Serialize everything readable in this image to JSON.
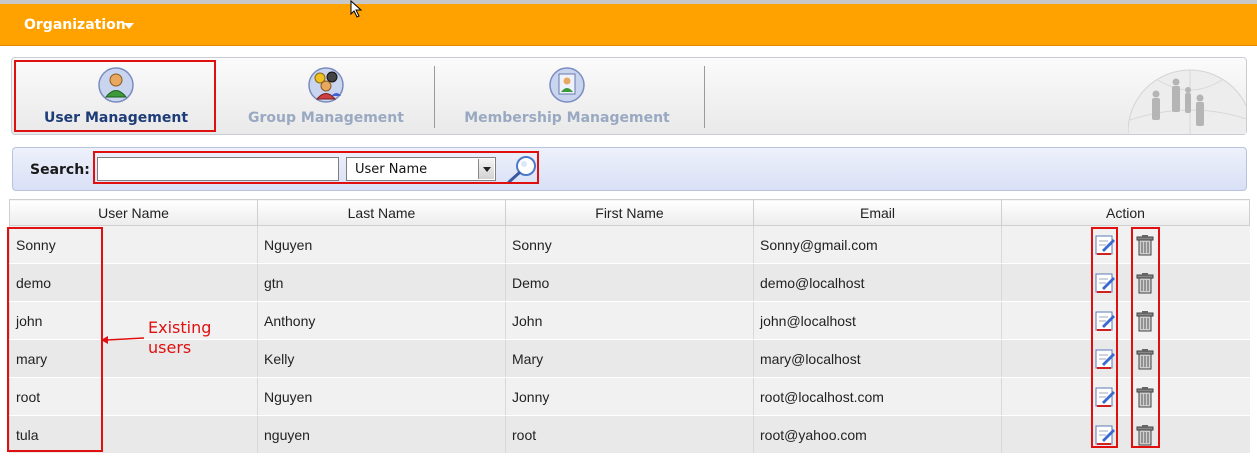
{
  "header": {
    "title": "Organization",
    "accent_color": "#ffa200",
    "menu_icon": "chevron-down-icon"
  },
  "tabs": [
    {
      "label": "User Management",
      "icon": "user-icon",
      "active": true
    },
    {
      "label": "Group Management",
      "icon": "group-icon",
      "active": false
    },
    {
      "label": "Membership Management",
      "icon": "membership-icon",
      "active": false
    }
  ],
  "search": {
    "label": "Search:",
    "value": "",
    "placeholder": "",
    "field_selected": "User Name",
    "button_icon": "magnifier-icon"
  },
  "table": {
    "columns": [
      "User Name",
      "Last Name",
      "First Name",
      "Email",
      "Action"
    ],
    "rows": [
      {
        "user_name": "Sonny",
        "last_name": "Nguyen",
        "first_name": "Sonny",
        "email": "Sonny@gmail.com"
      },
      {
        "user_name": "demo",
        "last_name": "gtn",
        "first_name": "Demo",
        "email": "demo@localhost"
      },
      {
        "user_name": "john",
        "last_name": "Anthony",
        "first_name": "John",
        "email": "john@localhost"
      },
      {
        "user_name": "mary",
        "last_name": "Kelly",
        "first_name": "Mary",
        "email": "mary@localhost"
      },
      {
        "user_name": "root",
        "last_name": "Nguyen",
        "first_name": "Jonny",
        "email": "root@localhost.com"
      },
      {
        "user_name": "tula",
        "last_name": "nguyen",
        "first_name": "root",
        "email": "root@yahoo.com"
      }
    ],
    "action_icons": [
      "edit-icon",
      "trash-icon"
    ]
  },
  "annotation": {
    "text": "Existing\nusers",
    "color": "#e01010"
  }
}
